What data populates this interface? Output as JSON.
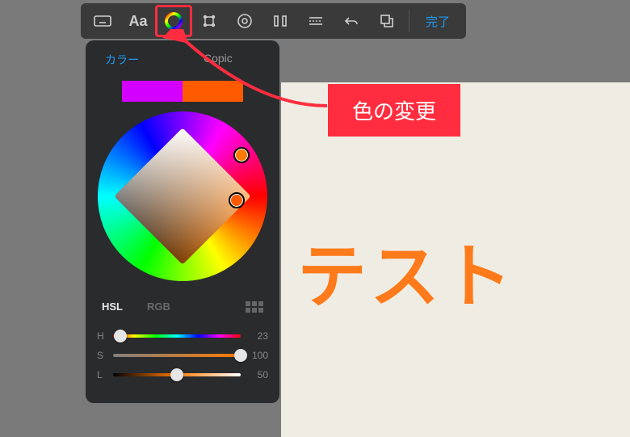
{
  "toolbar": {
    "done_label": "完了"
  },
  "panel": {
    "tab_color": "カラー",
    "tab_copic": "Copic",
    "swatch_left": "#d400ff",
    "swatch_right": "#ff5a00",
    "mode_hsl": "HSL",
    "mode_rgb": "RGB",
    "h": {
      "label": "H",
      "value": "23",
      "pct": 6
    },
    "s": {
      "label": "S",
      "value": "100",
      "pct": 100
    },
    "l": {
      "label": "L",
      "value": "50",
      "pct": 50
    }
  },
  "canvas": {
    "text": "テスト"
  },
  "callout": {
    "text": "色の変更"
  }
}
